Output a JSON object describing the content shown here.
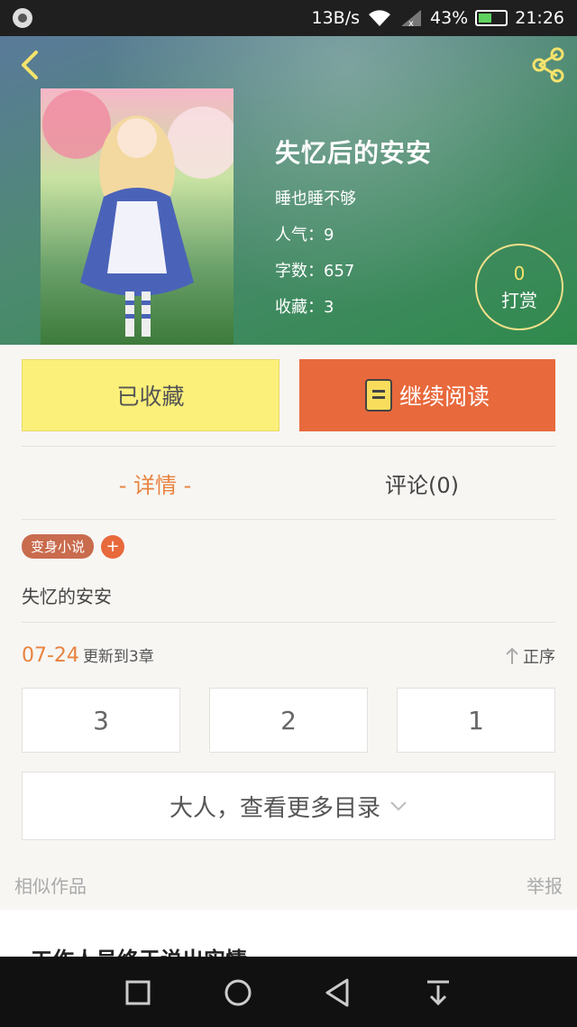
{
  "status_bar": {
    "net_speed": "13B/s",
    "battery": "43%",
    "time": "21:26",
    "battery_level": 0.43
  },
  "book": {
    "title": "失忆后的安安",
    "author": "睡也睡不够",
    "popularity_label": "人气：",
    "popularity": "9",
    "words_label": "字数：",
    "words": "657",
    "favorites_label": "收藏：",
    "favorites": "3",
    "cover_icon": "cover-illustration"
  },
  "reward": {
    "count": "0",
    "label": "打赏"
  },
  "actions": {
    "favorited_label": "已收藏",
    "read_label": "继续阅读"
  },
  "tabs": {
    "details": "- 详情 -",
    "comments": "评论(0)"
  },
  "tag": {
    "name": "变身小说",
    "add": "+"
  },
  "synopsis": "失忆的安安",
  "update": {
    "date": "07-24",
    "text": "更新到3章",
    "sort_label": "正序"
  },
  "chapters": [
    "3",
    "2",
    "1"
  ],
  "more_catalog": "大人，查看更多目录",
  "similar": {
    "label": "相似作品",
    "report": "举报",
    "first_title": "工作人员终于说出实情"
  },
  "colors": {
    "accent": "#e8693c",
    "favorite_bg": "#fbf07a",
    "tag": "#c96b4d",
    "active_tab": "#e8833f"
  }
}
